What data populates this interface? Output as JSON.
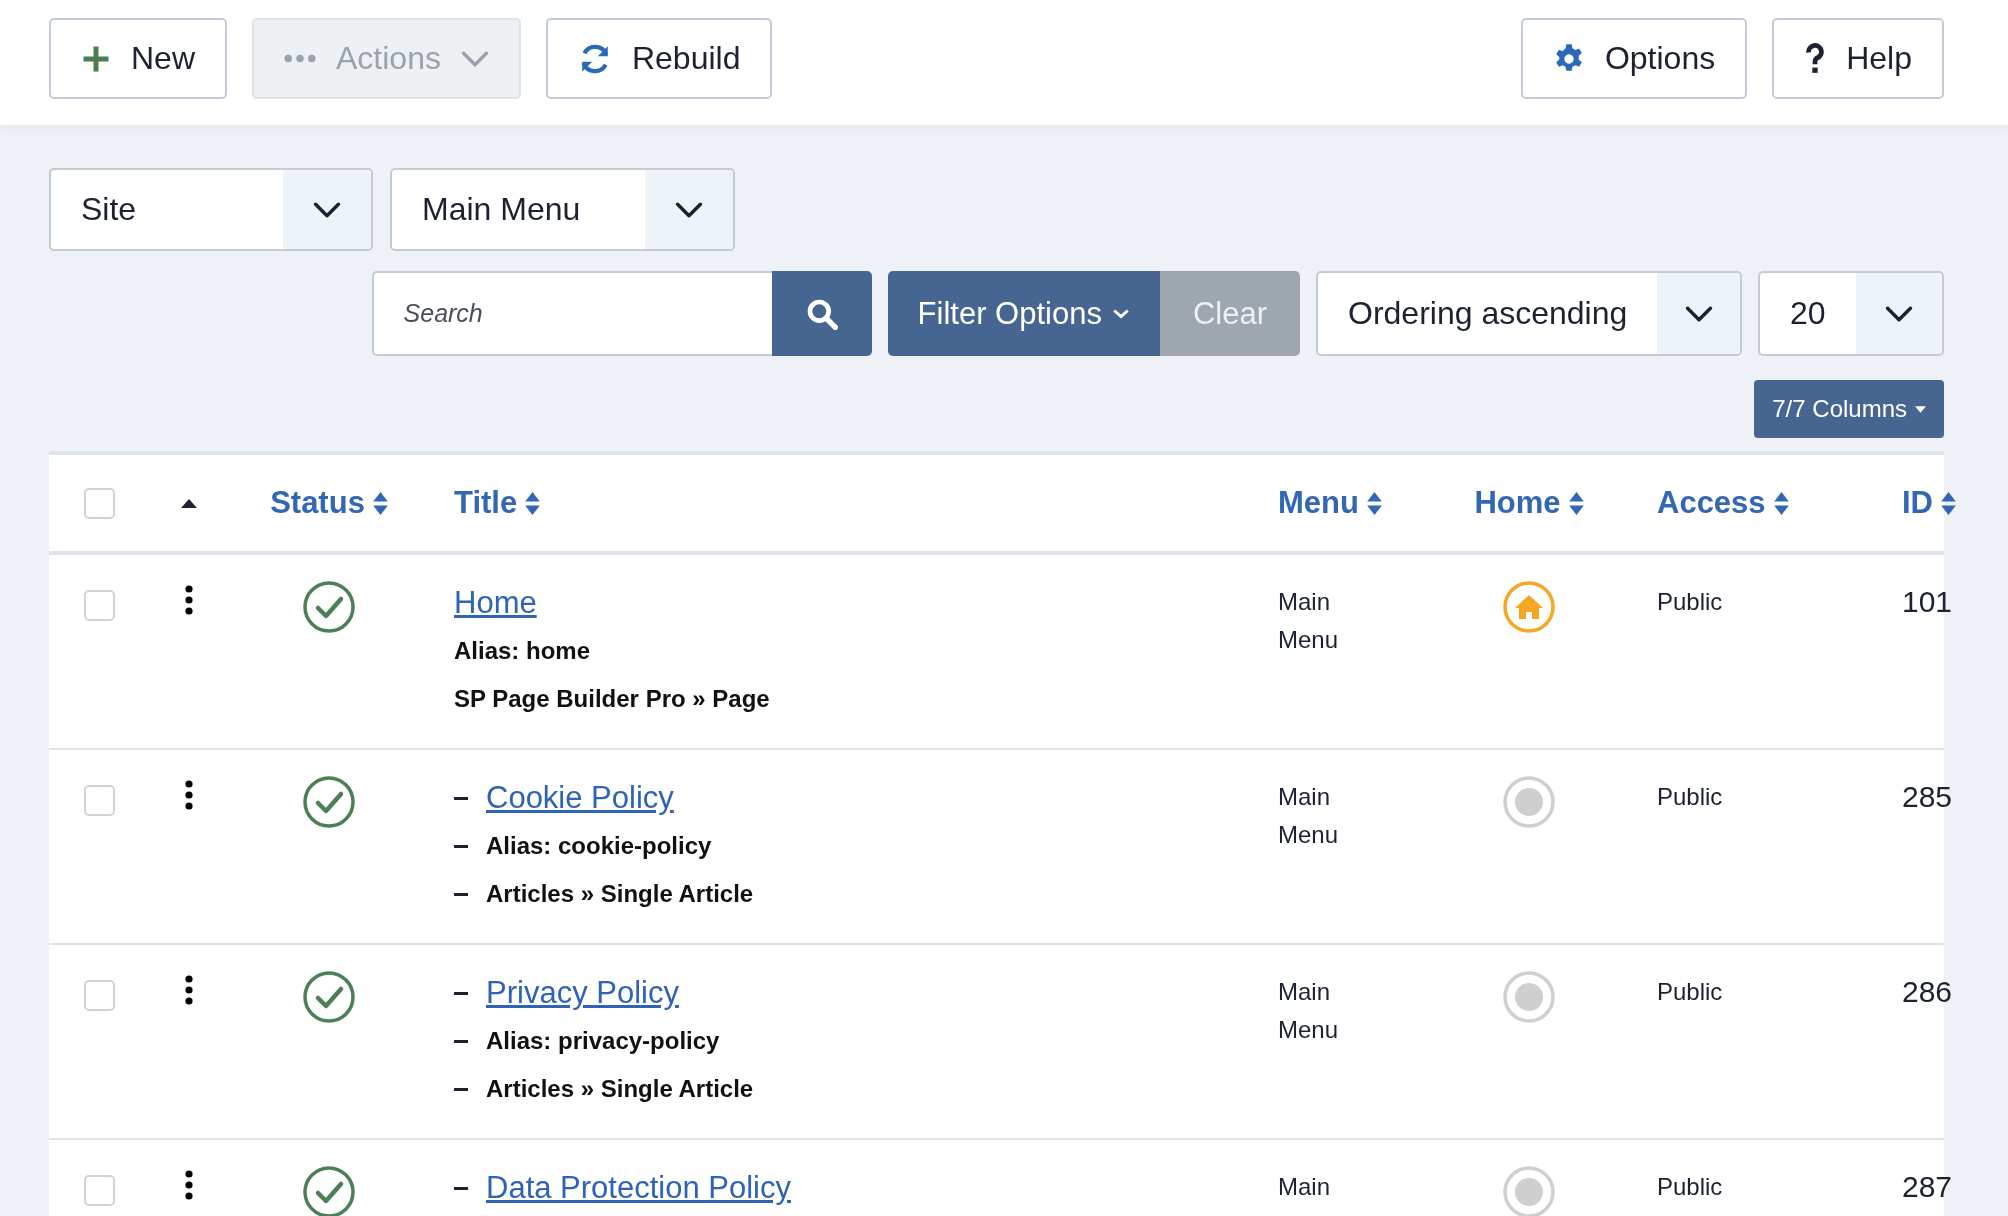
{
  "toolbar": {
    "buttons": [
      {
        "kind": "new",
        "label": "New",
        "disabled": false
      },
      {
        "kind": "actions",
        "label": "Actions",
        "disabled": true
      },
      {
        "kind": "rebuild",
        "label": "Rebuild",
        "disabled": false
      }
    ],
    "right_buttons": [
      {
        "kind": "options",
        "label": "Options",
        "disabled": false
      },
      {
        "kind": "help",
        "label": "Help",
        "disabled": false
      }
    ]
  },
  "filters": {
    "client": "Site",
    "menu": "Main Menu",
    "search": {
      "placeholder": "Search"
    },
    "filter_options": "Filter Options",
    "clear": "Clear",
    "ordering": "Ordering ascending",
    "limit": "20",
    "columns": "7/7 Columns"
  },
  "table": {
    "select_all": {
      "checked": false
    },
    "columns": [
      {
        "kind": "ordering",
        "sorted": true
      },
      {
        "kind": "sortable",
        "label": "Status"
      },
      {
        "kind": "sortable",
        "label": "Title"
      },
      {
        "kind": "sortable",
        "label": "Menu"
      },
      {
        "kind": "sortable",
        "label": "Home"
      },
      {
        "kind": "sortable",
        "label": "Access"
      },
      {
        "kind": "sortable",
        "label": "ID"
      }
    ],
    "rows": [
      {
        "checked": false,
        "published": true,
        "title": "Home",
        "alias": "Alias: home",
        "type": "SP Page Builder Pro » Page",
        "menu": "Main Menu",
        "home": true,
        "access": "Public",
        "id": "101",
        "children": [
          {
            "checked": false,
            "published": true,
            "title": "Cookie Policy",
            "alias": "Alias: cookie-policy",
            "type": "Articles » Single Article",
            "menu": "Main Menu",
            "home": false,
            "access": "Public",
            "id": "285"
          },
          {
            "checked": false,
            "published": true,
            "title": "Privacy Policy",
            "alias": "Alias: privacy-policy",
            "type": "Articles » Single Article",
            "menu": "Main Menu",
            "home": false,
            "access": "Public",
            "id": "286"
          },
          {
            "checked": false,
            "published": true,
            "title": "Data Protection Policy",
            "menu": "Main",
            "home": false,
            "access": "Public",
            "id": "287"
          }
        ]
      }
    ]
  }
}
